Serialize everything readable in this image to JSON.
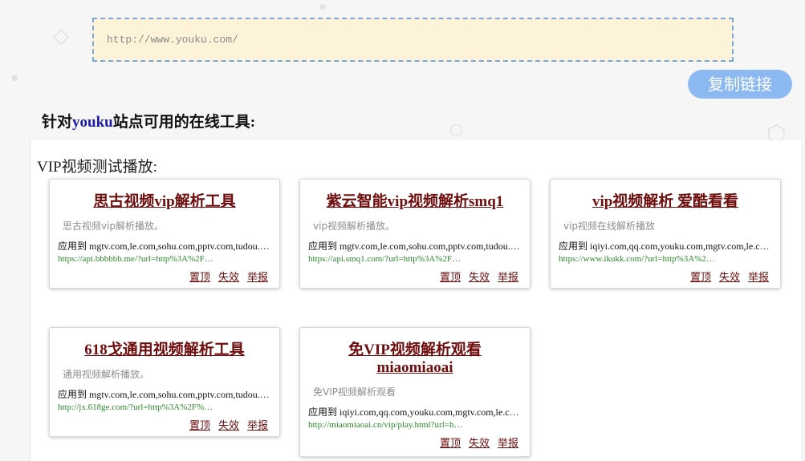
{
  "url_input": {
    "value": "http://www.youku.com/"
  },
  "copy_button": {
    "label": "复制链接"
  },
  "heading": {
    "prefix": "针对",
    "site": "youku",
    "suffix": "站点可用的在线工具:"
  },
  "section": {
    "title": "VIP视频测试播放:"
  },
  "cards": [
    {
      "title": "思古视频vip解析工具",
      "desc": "思古视频vip解析播放。",
      "applies": "应用到 mgtv.com,le.com,sohu.com,pptv.com,tudou.…",
      "link": "https://api.bbbbbb.me/?url=http%3A%2F…",
      "actions": [
        "置顶",
        "失效",
        "举报"
      ]
    },
    {
      "title": "紫云智能vip视频解析smq1",
      "desc": "vip视频解析播放。",
      "applies": "应用到 mgtv.com,le.com,sohu.com,pptv.com,tudou.…",
      "link": "https://api.smq1.com/?url=http%3A%2F…",
      "actions": [
        "置顶",
        "失效",
        "举报"
      ]
    },
    {
      "title": "vip视频解析 爱酷看看",
      "desc": "vip视频在线解析播放",
      "applies": "应用到 iqiyi.com,qq.com,youku.com,mgtv.com,le.c…",
      "link": "https://www.ikukk.com/?url=http%3A%2…",
      "actions": [
        "置顶",
        "失效",
        "举报"
      ]
    },
    {
      "title": "618戈通用视频解析工具",
      "desc": "通用视频解析播放。",
      "applies": "应用到 mgtv.com,le.com,sohu.com,pptv.com,tudou.…",
      "link": "http://jx.618ge.com/?url=http%3A%2F%…",
      "actions": [
        "置顶",
        "失效",
        "举报"
      ]
    },
    {
      "title": "免VIP视频解析观看miaomiaoai",
      "desc": "免VIP视频解析观看",
      "applies": "应用到 iqiyi.com,qq.com,youku.com,mgtv.com,le.c…",
      "link": "http://miaomiaoai.cn/vip/play.html?url=h…",
      "actions": [
        "置顶",
        "失效",
        "举报"
      ]
    }
  ]
}
